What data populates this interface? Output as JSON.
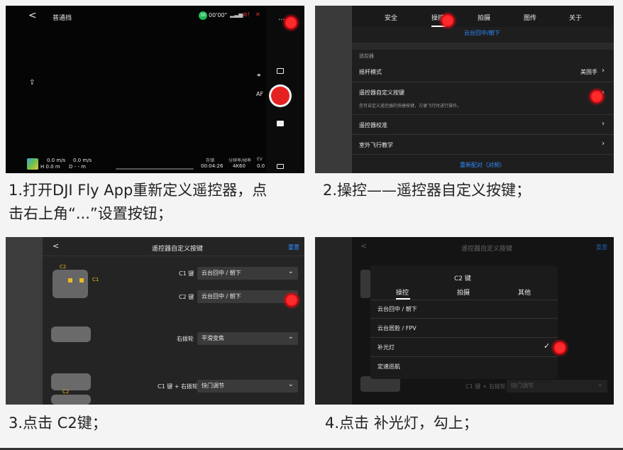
{
  "captions": {
    "step1": "1.打开DJI Fly App重新定义遥控器，点击右上角“...”设置按钮；",
    "step1_line1": "1.打开DJI Fly App重新定义遥控器，点",
    "step1_line2": "击右上角“...”设置按钮；",
    "step2": "2.操控——遥控器自定义按键；",
    "step3": "3.点击 C2键；",
    "step4": "4.点击 补光灯，勾上；"
  },
  "panel1": {
    "back": "<",
    "mode": "普通挡",
    "battery": "00'00\"",
    "battery_pct": "30",
    "more": "···",
    "af": "AF",
    "speed_h": "0.0 m/s",
    "speed_v": "0.0 m/s",
    "height": "H 0.0 m",
    "dist": "D - - m",
    "store_label": "存储",
    "store_val": "00:04:26",
    "res_label": "分辨率/帧率",
    "res_val": "4K60",
    "ev_label": "EV",
    "ev_val": "0.0"
  },
  "panel2": {
    "tabs": [
      "安全",
      "操控",
      "拍摄",
      "图传",
      "关于"
    ],
    "top_link": "云台回中/朝下",
    "section": "遥控器",
    "rows": [
      {
        "label": "摇杆模式",
        "value": "美国手"
      },
      {
        "label": "遥控器自定义按键",
        "desc": "您可自定义遥控器的快捷按键，方便飞行时进行操作。"
      },
      {
        "label": "遥控器校准"
      },
      {
        "label": "室外飞行教学"
      }
    ],
    "bottom_link": "重新配对（对频）"
  },
  "panel3": {
    "back": "<",
    "title": "遥控器自定义按键",
    "reset": "重置",
    "c2_tag": "C2",
    "c1_tag": "C1",
    "c2_tag_b": "C2",
    "fields": [
      {
        "label": "C1 键",
        "value": "云台回中 / 朝下"
      },
      {
        "label": "C2 键",
        "value": "云台回中 / 朝下"
      },
      {
        "label": "右拨轮",
        "value": "平滑变焦"
      },
      {
        "label": "C1 键 + 右拨轮",
        "value": "快门调节"
      }
    ]
  },
  "panel4": {
    "back": "<",
    "title": "遥控器自定义按键",
    "reset": "重置",
    "modal_title": "C2 键",
    "tabs": [
      "操控",
      "拍摄",
      "其他"
    ],
    "options": [
      "云台回中 / 朝下",
      "云台居脸 / FPV",
      "补光灯",
      "定速巡航"
    ],
    "checked_index": 2,
    "check": "✓",
    "bg_field_label": "C1 键 + 右拨轮",
    "bg_field_value": "快门调节"
  },
  "colors": {
    "accent_blue": "#2f8bff",
    "marker_red": "#e30613",
    "shutter_red": "#e52222"
  }
}
